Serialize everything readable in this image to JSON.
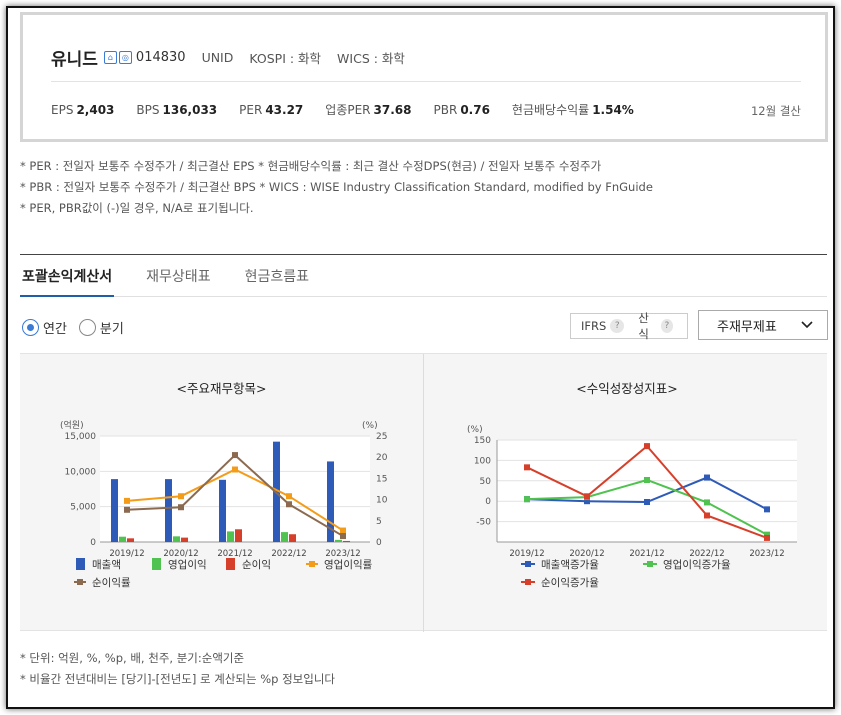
{
  "summary": {
    "company_name": "유니드",
    "code": "014830",
    "ticker": "UNID",
    "market": "KOSPI : 화학",
    "wics": "WICS : 화학",
    "metrics": [
      {
        "label": "EPS",
        "value": "2,403"
      },
      {
        "label": "BPS",
        "value": "136,033"
      },
      {
        "label": "PER",
        "value": "43.27"
      },
      {
        "label": "업종PER",
        "value": "37.68"
      },
      {
        "label": "PBR",
        "value": "0.76"
      },
      {
        "label": "현금배당수익률",
        "value": "1.54%"
      }
    ],
    "settlement": "12월 결산"
  },
  "notes": [
    "* PER : 전일자 보통주 수정주가 / 최근결산 EPS * 현금배당수익률 : 최근 결산 수정DPS(현금) / 전일자 보통주 수정주가",
    "* PBR : 전일자 보통주 수정주가 / 최근결산 BPS * WICS : WISE Industry Classification Standard, modified by FnGuide",
    "* PER, PBR값이 (-)일 경우, N/A로 표기됩니다."
  ],
  "tabs": [
    "포괄손익계산서",
    "재무상태표",
    "현금흐름표"
  ],
  "period": {
    "annual": "연간",
    "quarter": "분기"
  },
  "options": {
    "ifrs": "IFRS",
    "calc": "산식",
    "qmark": "?",
    "select": "주재무제표"
  },
  "charts": {
    "left_title": "<주요재무항목>",
    "right_title": "<수익성장성지표>"
  },
  "chart_data": [
    {
      "type": "bar",
      "title": "<주요재무항목>",
      "ylabel": "(억원)",
      "y2label": "(%)",
      "ylim": [
        0,
        15000
      ],
      "yticks": [
        "0",
        "5,000",
        "10,000",
        "15,000"
      ],
      "y2lim": [
        0,
        25
      ],
      "y2ticks": [
        "0",
        "5",
        "10",
        "15",
        "20",
        "25"
      ],
      "categories": [
        "2019/12",
        "2020/12",
        "2021/12",
        "2022/12",
        "2023/12"
      ],
      "series": [
        {
          "name": "매출액",
          "kind": "bar",
          "axis": "left",
          "color": "#2e5ab8",
          "values": [
            8900,
            8900,
            8800,
            14200,
            11400
          ]
        },
        {
          "name": "영업이익",
          "kind": "bar",
          "axis": "left",
          "color": "#4fc24f",
          "values": [
            750,
            800,
            1500,
            1400,
            300
          ]
        },
        {
          "name": "순이익",
          "kind": "bar",
          "axis": "left",
          "color": "#d6402b",
          "values": [
            520,
            620,
            1800,
            1100,
            150
          ]
        },
        {
          "name": "영업이익률",
          "kind": "line",
          "axis": "right",
          "color": "#f39c1a",
          "values": [
            9.7,
            10.8,
            17.1,
            10.8,
            2.7
          ]
        },
        {
          "name": "순이익률",
          "kind": "line",
          "axis": "right",
          "color": "#8b6a4f",
          "values": [
            7.6,
            8.2,
            20.5,
            8.9,
            1.4
          ]
        }
      ]
    },
    {
      "type": "line",
      "title": "<수익성장성지표>",
      "ylabel": "(%)",
      "ylim": [
        -100,
        150
      ],
      "yticks": [
        "-50",
        "0",
        "50",
        "100",
        "150"
      ],
      "categories": [
        "2019/12",
        "2020/12",
        "2021/12",
        "2022/12",
        "2023/12"
      ],
      "series": [
        {
          "name": "매출액증가율",
          "color": "#2e5ab8",
          "values": [
            5,
            0,
            -2,
            58,
            -20
          ]
        },
        {
          "name": "영업이익증가율",
          "color": "#4fc24f",
          "values": [
            5,
            10,
            52,
            -3,
            -82
          ]
        },
        {
          "name": "순이익증가율",
          "color": "#d6402b",
          "values": [
            83,
            12,
            135,
            -35,
            -90
          ]
        }
      ]
    }
  ],
  "bottom_notes": [
    "* 단위: 억원, %, %p, 배, 천주, 분기:순액기준",
    "* 비율간 전년대비는 [당기]-[전년도] 로 계산되는 %p 정보입니다"
  ]
}
